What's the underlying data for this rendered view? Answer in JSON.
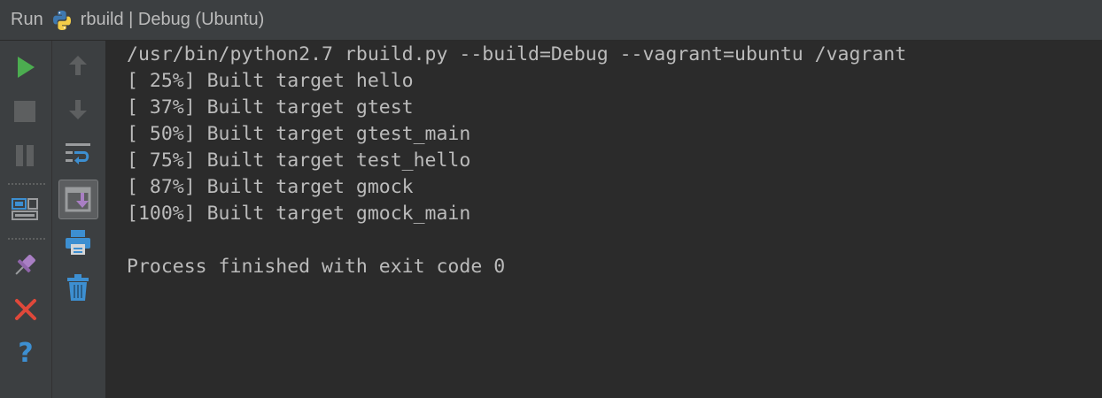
{
  "header": {
    "run_label": "Run",
    "config_title": "rbuild | Debug (Ubuntu)"
  },
  "left_toolbar": {
    "buttons": [
      {
        "icon": "play-icon",
        "color": "#4cad50"
      },
      {
        "icon": "stop-icon",
        "color": "#5d5f60"
      },
      {
        "icon": "pause-icon",
        "color": "#5d5f60"
      },
      {
        "icon": "layout-icon",
        "color": "#3d8fd1"
      },
      {
        "icon": "pin-icon",
        "color": "#a97fc4"
      },
      {
        "icon": "close-icon",
        "color": "#e0483a"
      },
      {
        "icon": "help-icon",
        "color": "#3d8fd1"
      }
    ]
  },
  "mid_toolbar": {
    "buttons": [
      {
        "icon": "arrow-up-icon"
      },
      {
        "icon": "arrow-down-icon"
      },
      {
        "icon": "soft-wrap-icon"
      },
      {
        "icon": "scroll-to-end-icon",
        "toggled": true
      },
      {
        "icon": "print-icon"
      },
      {
        "icon": "trash-icon"
      }
    ]
  },
  "console": {
    "lines": [
      "/usr/bin/python2.7 rbuild.py --build=Debug --vagrant=ubuntu /vagrant",
      "[ 25%] Built target hello",
      "[ 37%] Built target gtest",
      "[ 50%] Built target gtest_main",
      "[ 75%] Built target test_hello",
      "[ 87%] Built target gmock",
      "[100%] Built target gmock_main",
      "",
      "Process finished with exit code 0"
    ]
  }
}
